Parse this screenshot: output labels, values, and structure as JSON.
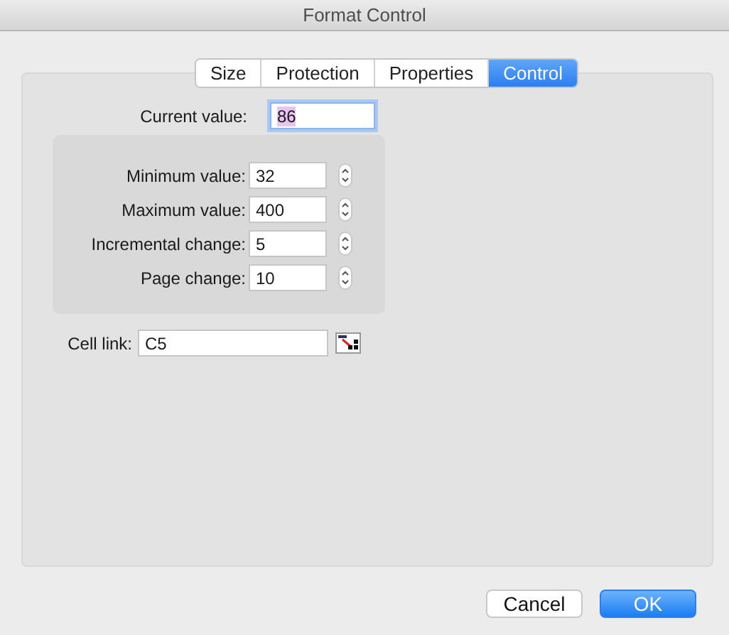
{
  "window": {
    "title": "Format Control"
  },
  "tabs": [
    {
      "label": "Size",
      "selected": false
    },
    {
      "label": "Protection",
      "selected": false
    },
    {
      "label": "Properties",
      "selected": false
    },
    {
      "label": "Control",
      "selected": true
    }
  ],
  "current_value": {
    "label": "Current value:",
    "value": "86",
    "text_selected": true
  },
  "ranges": [
    {
      "label": "Minimum value:",
      "value": "32"
    },
    {
      "label": "Maximum value:",
      "value": "400"
    },
    {
      "label": "Incremental change:",
      "value": "5"
    },
    {
      "label": "Page change:",
      "value": "10"
    }
  ],
  "cell_link": {
    "label": "Cell link:",
    "value": "C5"
  },
  "buttons": [
    {
      "label": "Cancel",
      "kind": "secondary"
    },
    {
      "label": "OK",
      "kind": "primary"
    }
  ]
}
